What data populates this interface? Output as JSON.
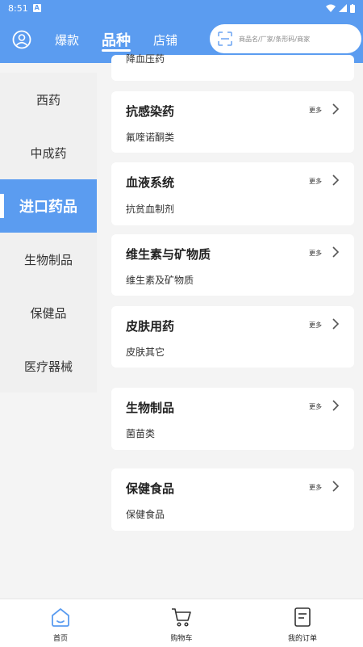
{
  "status": {
    "time": "8:51"
  },
  "header": {
    "tabs": [
      {
        "label": "爆款",
        "active": false
      },
      {
        "label": "品种",
        "active": true
      },
      {
        "label": "店铺",
        "active": false
      }
    ],
    "search_placeholder": "商品名/厂家/条形码/商家"
  },
  "sidebar": {
    "items": [
      {
        "label": "西药"
      },
      {
        "label": "中成药"
      },
      {
        "label": "进口药品"
      },
      {
        "label": "生物制品"
      },
      {
        "label": "保健品"
      },
      {
        "label": "医疗器械"
      }
    ]
  },
  "cards": {
    "partial": {
      "sub": "降血压药"
    },
    "items": [
      {
        "title": "抗感染药",
        "more": "更多",
        "sub": "氟喹诺酮类"
      },
      {
        "title": "血液系统",
        "more": "更多",
        "sub": "抗贫血制剂"
      },
      {
        "title": "维生素与矿物质",
        "more": "更多",
        "sub": "维生素及矿物质"
      },
      {
        "title": "皮肤用药",
        "more": "更多",
        "sub": "皮肤其它"
      },
      {
        "title": "生物制品",
        "more": "更多",
        "sub": "菌苗类"
      },
      {
        "title": "保健食品",
        "more": "更多",
        "sub": "保健食品"
      }
    ]
  },
  "bottom_nav": {
    "items": [
      {
        "label": "首页",
        "icon": "home-icon"
      },
      {
        "label": "购物车",
        "icon": "cart-icon"
      },
      {
        "label": "我的订单",
        "icon": "order-icon"
      }
    ]
  },
  "colors": {
    "accent": "#5b9cf0",
    "background": "#f4f4f4"
  }
}
